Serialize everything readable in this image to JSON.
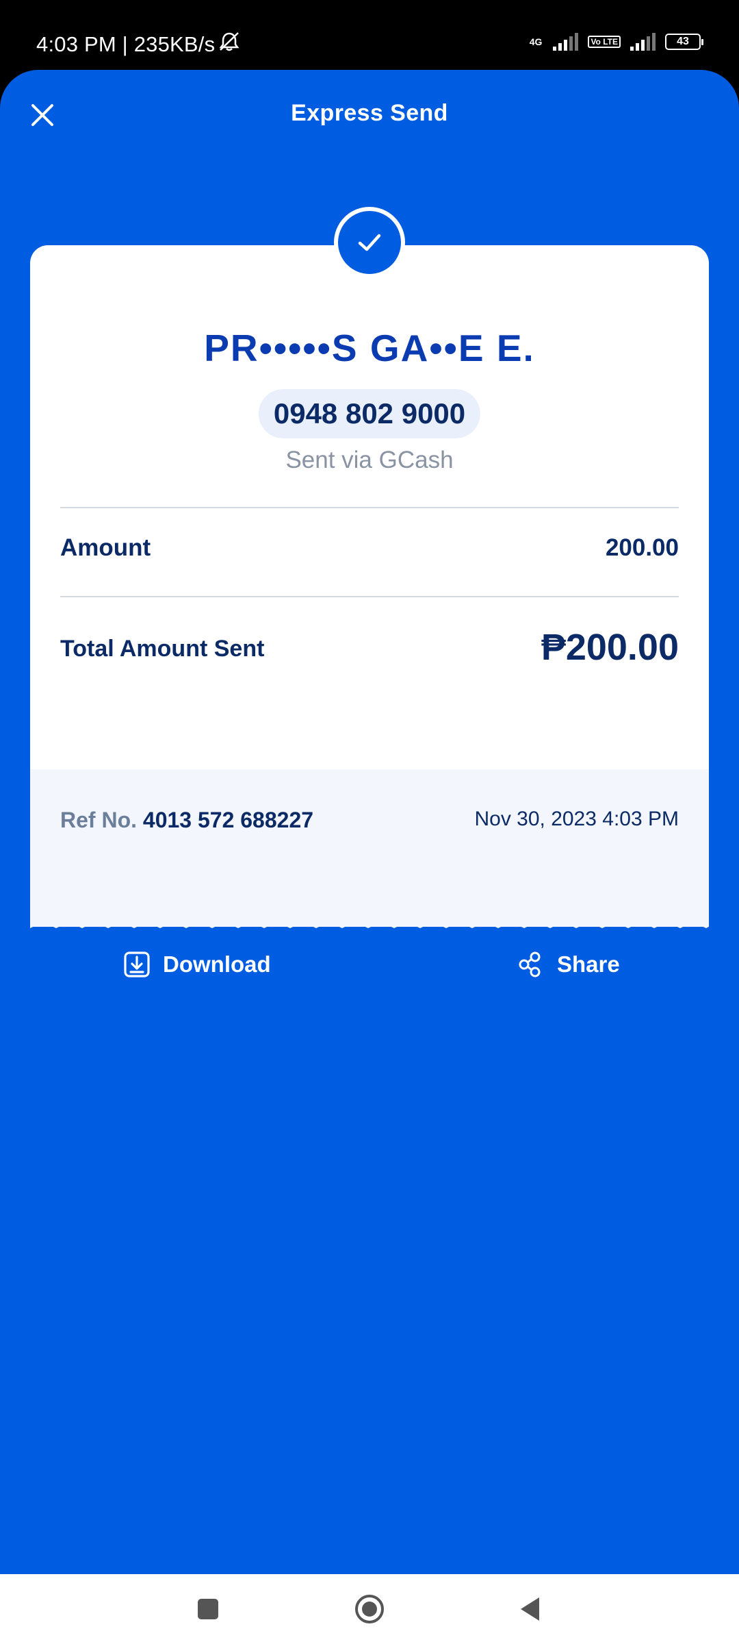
{
  "status_bar": {
    "time_speed": "4:03 PM | 235KB/s",
    "network_label": "4G",
    "volte_label": "Vo LTE",
    "battery": "43"
  },
  "header": {
    "title": "Express Send"
  },
  "receipt": {
    "recipient_name": "PR•••••S GA••E E.",
    "phone_number": "0948 802 9000",
    "sent_via": "Sent via GCash",
    "amount_label": "Amount",
    "amount_value": "200.00",
    "total_label": "Total Amount Sent",
    "total_value": "₱200.00",
    "ref_label": "Ref No.",
    "ref_number": "4013 572 688227",
    "date_time": "Nov 30, 2023 4:03 PM"
  },
  "actions": {
    "download_label": "Download",
    "share_label": "Share"
  },
  "colors": {
    "brand_blue": "#005CE1",
    "text_dark_blue": "#0b2a66"
  }
}
